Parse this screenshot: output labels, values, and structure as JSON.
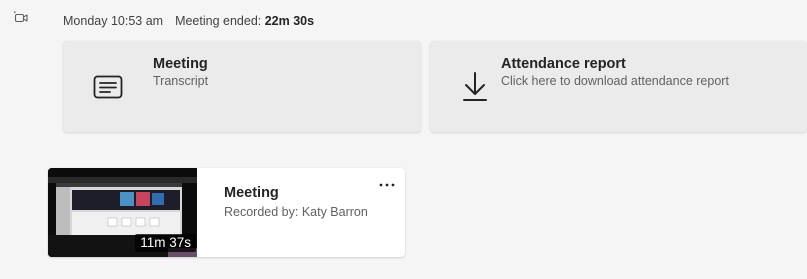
{
  "header": {
    "date_time": "Monday 10:53 am",
    "ended_label": "Meeting ended:",
    "duration": "22m 30s"
  },
  "transcript_card": {
    "title": "Meeting",
    "subtitle": "Transcript",
    "icon": "transcript-icon"
  },
  "attendance_card": {
    "title": "Attendance report",
    "subtitle": "Click here to download attendance report",
    "icon": "download-icon"
  },
  "recording": {
    "title": "Meeting",
    "subtitle": "Recorded by: Katy Barron",
    "duration": "11m 37s",
    "more_icon": "more-options-icon"
  }
}
